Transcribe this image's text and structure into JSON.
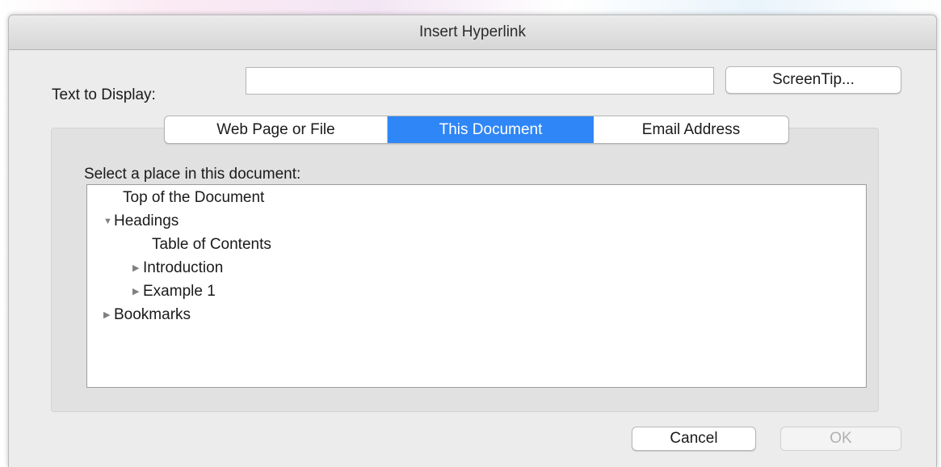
{
  "window": {
    "title": "Insert Hyperlink"
  },
  "display": {
    "label": "Text to Display:",
    "value": "",
    "screentip_label": "ScreenTip..."
  },
  "tabs": [
    {
      "label": "Web Page or File",
      "selected": false
    },
    {
      "label": "This Document",
      "selected": true
    },
    {
      "label": "Email Address",
      "selected": false
    }
  ],
  "panel": {
    "prompt": "Select a place in this document:",
    "tree": {
      "top": "Top of the Document",
      "headings": "Headings",
      "toc": "Table of Contents",
      "introduction": "Introduction",
      "example1": "Example 1",
      "bookmarks": "Bookmarks"
    }
  },
  "footer": {
    "cancel_label": "Cancel",
    "ok_label": "OK"
  },
  "colors": {
    "selected_tab": "#2f86f6",
    "dialog_bg": "#ececec"
  }
}
